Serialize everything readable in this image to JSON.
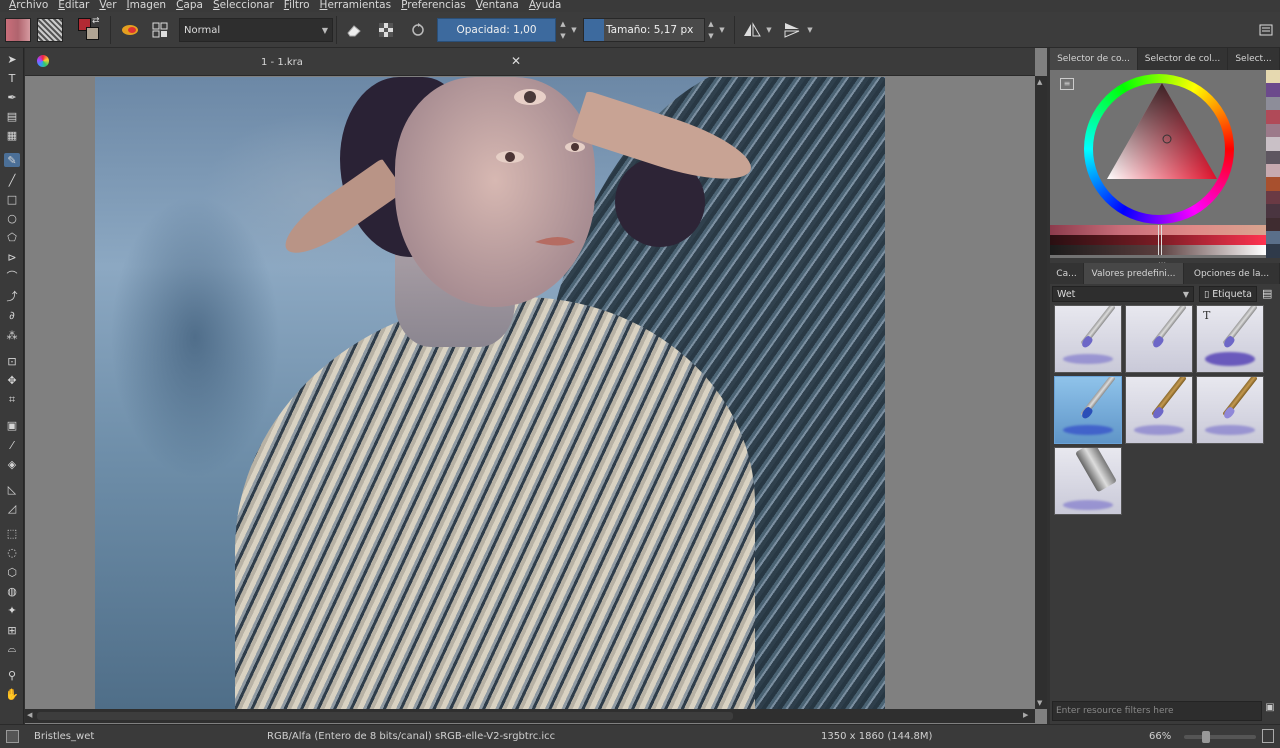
{
  "menu": [
    "Archivo",
    "Editar",
    "Ver",
    "Imagen",
    "Capa",
    "Seleccionar",
    "Filtro",
    "Herramientas",
    "Preferencias",
    "Ventana",
    "Ayuda"
  ],
  "toolbar": {
    "blend_mode": "Normal",
    "opacity_label": "Opacidad:",
    "opacity_value": "1,00",
    "size_label": "Tamaño:",
    "size_value": "5,17 px",
    "colors": {
      "foreground": "#b22a33",
      "background": "#b0a493"
    }
  },
  "document": {
    "tab_title": "1 - 1.kra"
  },
  "dock": {
    "color_tabs": [
      "Selector de co...",
      "Selector de col...",
      "Select..."
    ],
    "preset_tabs": [
      "Ca...",
      "Valores predefini...",
      "Opciones de la..."
    ],
    "preset_filter": "Wet",
    "tag_label": "Etiqueta",
    "resource_filter_placeholder": "Enter resource filters here",
    "palette_colors": [
      "#e6d9b0",
      "#6c4a8c",
      "#8d8d99",
      "#b04a58",
      "#9c7a8a",
      "#c9c0c6",
      "#5e5660",
      "#c7aab0",
      "#a8502e",
      "#6a3a44",
      "#4a3540",
      "#3f2c30",
      "#5a6f8a",
      "#2f3a4a"
    ]
  },
  "status": {
    "brush_name": "Bristles_wet",
    "color_space": "RGB/Alfa (Entero de 8 bits/canal)  sRGB-elle-V2-srgbtrc.icc",
    "dimensions": "1350 x 1860 (144.8M)",
    "zoom": "66%"
  }
}
